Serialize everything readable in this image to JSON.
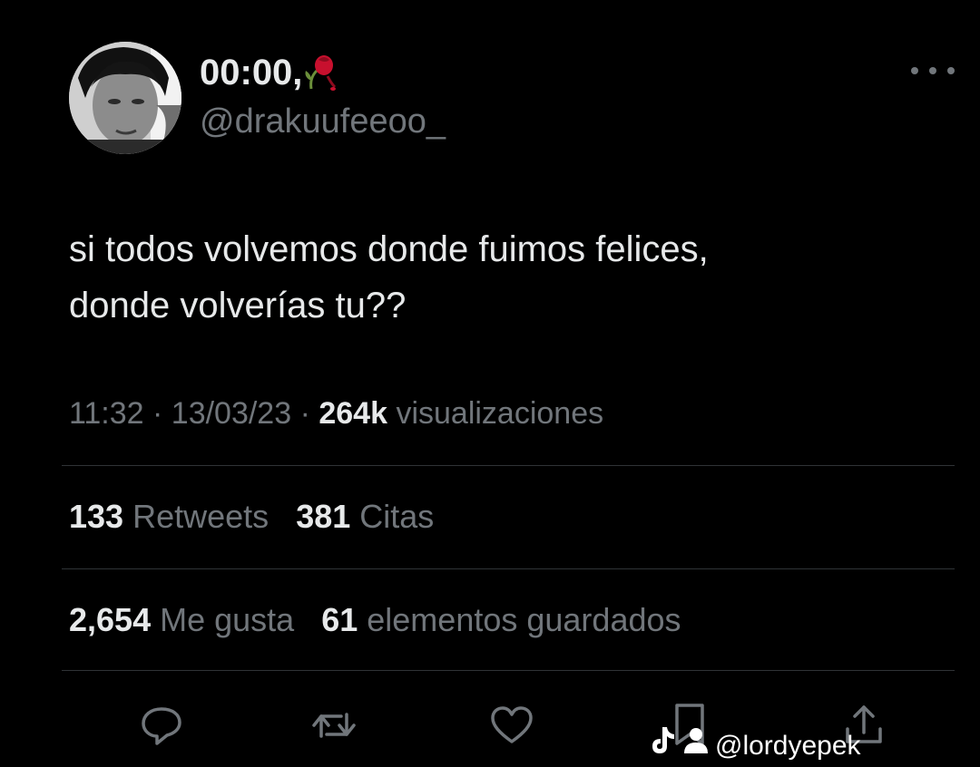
{
  "tweet": {
    "author": {
      "display_name": "00:00,",
      "name_emoji": "wilted-rose-icon",
      "handle": "@drakuufeeoo_"
    },
    "text_lines": [
      "si todos volvemos donde fuimos felices,",
      "donde volverías tu??"
    ],
    "meta": {
      "time": "11:32",
      "separator": " · ",
      "date": "13/03/23",
      "views_count": "264k",
      "views_label": "visualizaciones"
    },
    "stats": {
      "retweets_count": "133",
      "retweets_label": "Retweets",
      "quotes_count": "381",
      "quotes_label": "Citas",
      "likes_count": "2,654",
      "likes_label": "Me gusta",
      "bookmarks_count": "61",
      "bookmarks_label": "elementos guardados"
    },
    "actions": [
      "reply-icon",
      "retweet-icon",
      "like-icon",
      "bookmark-icon",
      "share-icon"
    ]
  },
  "watermark": {
    "platform_icon": "tiktok-icon",
    "user_icon": "user-icon",
    "handle": "@lordyepek"
  },
  "colors": {
    "background": "#000000",
    "text_primary": "#e7e9ea",
    "text_secondary": "#71767b",
    "divider": "#2f3336",
    "rose_red": "#c8102e"
  }
}
